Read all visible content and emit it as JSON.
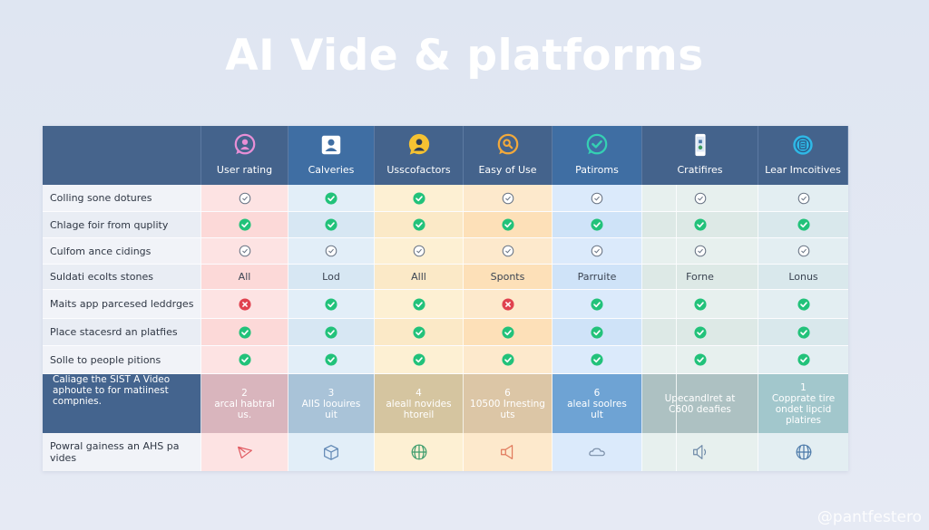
{
  "page": {
    "title": "AI Vide & platforms",
    "watermark": "@pantfestero"
  },
  "colors": {
    "header_bg": "#44638c",
    "check_green": "#22c27a",
    "cross_red": "#e0424f",
    "outline_gray": "#6b7686"
  },
  "table": {
    "columns": [
      {
        "label": "User rating",
        "icon": "user-chat-bubble-icon",
        "icon_color": "#e88fd6"
      },
      {
        "label": "Calveries",
        "icon": "user-card-icon",
        "icon_color": "#ffffff"
      },
      {
        "label": "Usscofactors",
        "icon": "user-chat-bubble-icon",
        "icon_color": "#f5c232"
      },
      {
        "label": "Easy of Use",
        "icon": "search-chat-bubble-icon",
        "icon_color": "#f2a93b"
      },
      {
        "label": "Patiroms",
        "icon": "check-chat-bubble-icon",
        "icon_color": "#35d0b3"
      },
      {
        "label": "Cratifires",
        "icon": "smartphone-icon",
        "icon_color": "#ffffff"
      },
      {
        "label": "Lear Imcoitives",
        "icon": "refresh-list-icon",
        "icon_color": "#2fb8e6"
      }
    ],
    "rows": [
      {
        "label": "Colling sone dotures",
        "cells": [
          "outline-check",
          "check",
          "check",
          "outline-check",
          "outline-check",
          "outline-check",
          "outline-check"
        ]
      },
      {
        "label": "Chlage foir from quplity",
        "cells": [
          "check",
          "check",
          "check",
          "check",
          "check",
          "check",
          "check"
        ]
      },
      {
        "label": "Culfom ance cidings",
        "cells": [
          "outline-check",
          "outline-check",
          "outline-check",
          "outline-check",
          "outline-check",
          "outline-check",
          "outline-check"
        ]
      },
      {
        "label": "Suldati ecolts stones",
        "cells": [
          "All",
          "Lod",
          "Alll",
          "Sponts",
          "Parruite",
          "Forne",
          "Lonus"
        ]
      },
      {
        "label": "Maits app parcesed leddrges",
        "cells": [
          "cross",
          "check",
          "check",
          "cross",
          "check",
          "check",
          "check"
        ]
      },
      {
        "label": "Place stacesrd an platfies",
        "cells": [
          "check",
          "check",
          "check",
          "check",
          "check",
          "check",
          "check"
        ]
      },
      {
        "label": "Solle to people pitions",
        "cells": [
          "check",
          "check",
          "check",
          "check",
          "check",
          "check",
          "check"
        ]
      }
    ],
    "highlight_row": {
      "label": "Caliage the SIST A Video aphoute to for matiinest compnies.",
      "cells": [
        {
          "line1": "2",
          "line2": "arcal habtral",
          "line3": "us."
        },
        {
          "line1": "3",
          "line2": "AIIS loouires",
          "line3": "uit"
        },
        {
          "line1": "4",
          "line2": "aleall novides",
          "line3": "htoreil"
        },
        {
          "line1": "6",
          "line2": "10500 Irnesting",
          "line3": "uts"
        },
        {
          "line1": "6",
          "line2": "aleal soolres",
          "line3": "ult"
        },
        {
          "line1": "",
          "line2": "Upecandlret at",
          "line3": "C600 deafies"
        },
        {
          "line1": "1",
          "line2": "Copprate tire",
          "line3": "ondet lipcid platires"
        }
      ]
    },
    "icon_row": {
      "label": "Powral gainess an AHS pa vides",
      "cells": [
        {
          "icon": "send-arrow-icon",
          "color": "#e0575e"
        },
        {
          "icon": "box-icon",
          "color": "#5f86b3"
        },
        {
          "icon": "globe-icon",
          "color": "#3a9b6a"
        },
        {
          "icon": "megaphone-icon",
          "color": "#e0785a"
        },
        {
          "icon": "cloud-icon",
          "color": "#7b8fa8"
        },
        {
          "icon": "speaker-icon",
          "color": "#6f8aa8"
        },
        {
          "icon": "globe-icon",
          "color": "#4a78a8"
        }
      ]
    }
  }
}
